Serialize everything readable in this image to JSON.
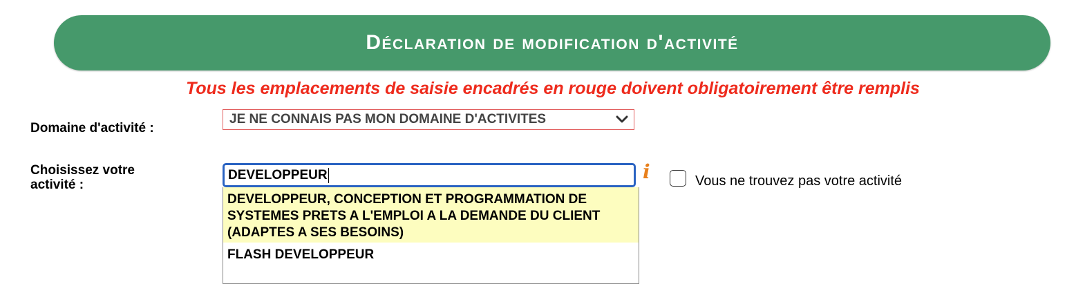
{
  "header": {
    "title": "Déclaration de modification d'activité"
  },
  "notice": "Tous les emplacements de saisie encadrés en rouge doivent obligatoirement être remplis",
  "domain": {
    "label": "Domaine d'activité :",
    "selected": "JE NE CONNAIS PAS MON DOMAINE D'ACTIVITES"
  },
  "activity": {
    "label_line1": "Choisissez votre",
    "label_line2": "activité :",
    "value": "DEVELOPPEUR",
    "not_found_label": "Vous ne trouvez pas votre activité"
  },
  "suggestions": [
    "DEVELOPPEUR, CONCEPTION ET PROGRAMMATION DE SYSTEMES PRETS A L'EMPLOI A LA DEMANDE DU CLIENT (ADAPTES A SES BESOINS)",
    "FLASH DEVELOPPEUR"
  ],
  "colors": {
    "banner": "#46996b",
    "notice": "#ee2b1d",
    "required_border": "#e26060",
    "focus_border": "#2a63c2",
    "highlight": "#fdfdbf",
    "info_icon": "#e8801c"
  },
  "icons": {
    "domain_dropdown": "chevron-down-icon",
    "info": "info-icon"
  }
}
